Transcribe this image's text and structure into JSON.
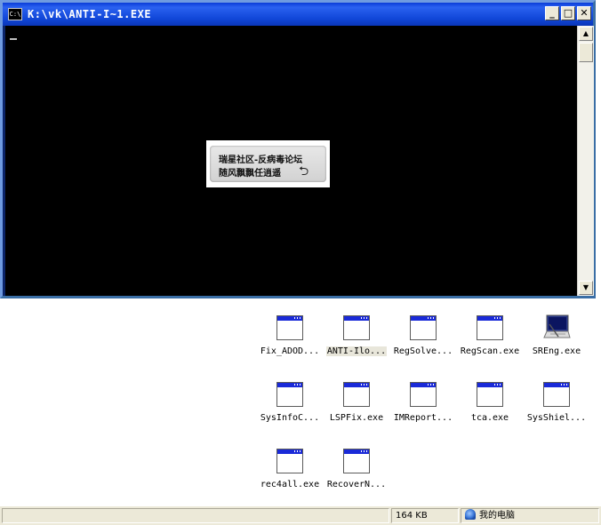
{
  "console": {
    "title": "K:\\vk\\ANTI-I~1.EXE",
    "icon_label": "C:\\",
    "buttons": {
      "minimize": "_",
      "maximize": "□",
      "close": "✕"
    },
    "watermark": {
      "line1": "瑞星社区-反病毒论坛",
      "line2": "随风飘飘任逍遥"
    }
  },
  "files": [
    {
      "label": "Fix_ADOD...",
      "icon": "app-window-icon",
      "selected": false
    },
    {
      "label": "ANTI-Ilo...",
      "icon": "app-window-icon",
      "selected": true
    },
    {
      "label": "RegSolve...",
      "icon": "app-window-icon",
      "selected": false
    },
    {
      "label": "RegScan.exe",
      "icon": "app-window-icon",
      "selected": false
    },
    {
      "label": "SREng.exe",
      "icon": "laptop-icon",
      "selected": false
    },
    {
      "label": "SysInfoC...",
      "icon": "app-window-icon",
      "selected": false
    },
    {
      "label": "LSPFix.exe",
      "icon": "app-window-icon",
      "selected": false
    },
    {
      "label": "IMReport...",
      "icon": "app-window-icon",
      "selected": false
    },
    {
      "label": "tca.exe",
      "icon": "app-window-icon",
      "selected": false
    },
    {
      "label": "SysShiel...",
      "icon": "app-window-icon",
      "selected": false
    },
    {
      "label": "rec4all.exe",
      "icon": "app-window-icon",
      "selected": false
    },
    {
      "label": "RecoverN...",
      "icon": "app-window-icon",
      "selected": false
    }
  ],
  "statusbar": {
    "size": "164 KB",
    "location": "我的电脑",
    "location_icon": "my-computer-icon"
  }
}
